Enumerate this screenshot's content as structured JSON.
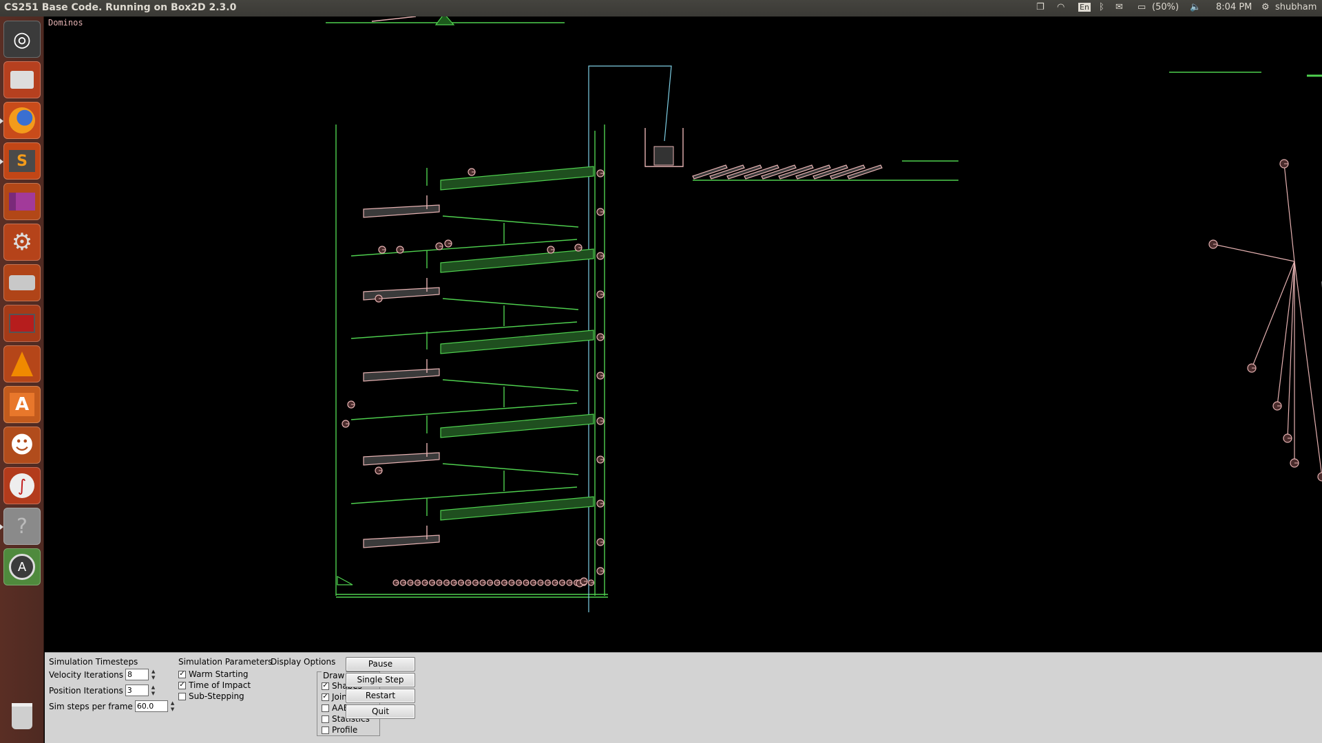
{
  "window": {
    "title": "CS251 Base Code. Running on Box2D 2.3.0"
  },
  "indicators": {
    "keyboard": "En",
    "battery": "(50%)",
    "clock": "8:04 PM",
    "user": "shubham"
  },
  "launcher": {
    "items": [
      {
        "name": "dash-home",
        "glyph": "◎"
      },
      {
        "name": "files",
        "glyph": "▭"
      },
      {
        "name": "firefox",
        "glyph": "●"
      },
      {
        "name": "sublime-text",
        "glyph": "S"
      },
      {
        "name": "workspace",
        "glyph": "▬"
      },
      {
        "name": "system-settings",
        "glyph": "⚙"
      },
      {
        "name": "disk",
        "glyph": "▱"
      },
      {
        "name": "terminal-app",
        "glyph": "▦"
      },
      {
        "name": "vlc",
        "glyph": "▲"
      },
      {
        "name": "software-center",
        "glyph": "A"
      },
      {
        "name": "pidgin",
        "glyph": "☻"
      },
      {
        "name": "document-viewer",
        "glyph": "∫"
      },
      {
        "name": "help",
        "glyph": "?"
      },
      {
        "name": "software-updater",
        "glyph": "A"
      },
      {
        "name": "trash",
        "glyph": "🗑"
      }
    ]
  },
  "simulation": {
    "test_name": "Dominos"
  },
  "panel": {
    "timesteps": {
      "header": "Simulation Timesteps",
      "velocity_label": "Velocity Iterations",
      "velocity_value": "8",
      "position_label": "Position Iterations",
      "position_value": "3",
      "hz_label": "Sim steps per frame",
      "hz_value": "60.0"
    },
    "params": {
      "header": "Simulation Parameters",
      "warm_starting": "Warm Starting",
      "time_of_impact": "Time of Impact",
      "sub_stepping": "Sub-Stepping"
    },
    "display": {
      "header": "Display Options",
      "draw": "Draw",
      "shapes": "Shapes",
      "joints": "Joints",
      "aabbs": "AABBs",
      "statistics": "Statistics",
      "profile": "Profile"
    },
    "buttons": {
      "pause": "Pause",
      "single_step": "Single Step",
      "restart": "Restart",
      "quit": "Quit"
    }
  },
  "colors": {
    "static": "#4fd14f",
    "dynamic": "#e6b2b2",
    "kinematic": "#7fd0e6",
    "panel": "#d3d3d3"
  }
}
